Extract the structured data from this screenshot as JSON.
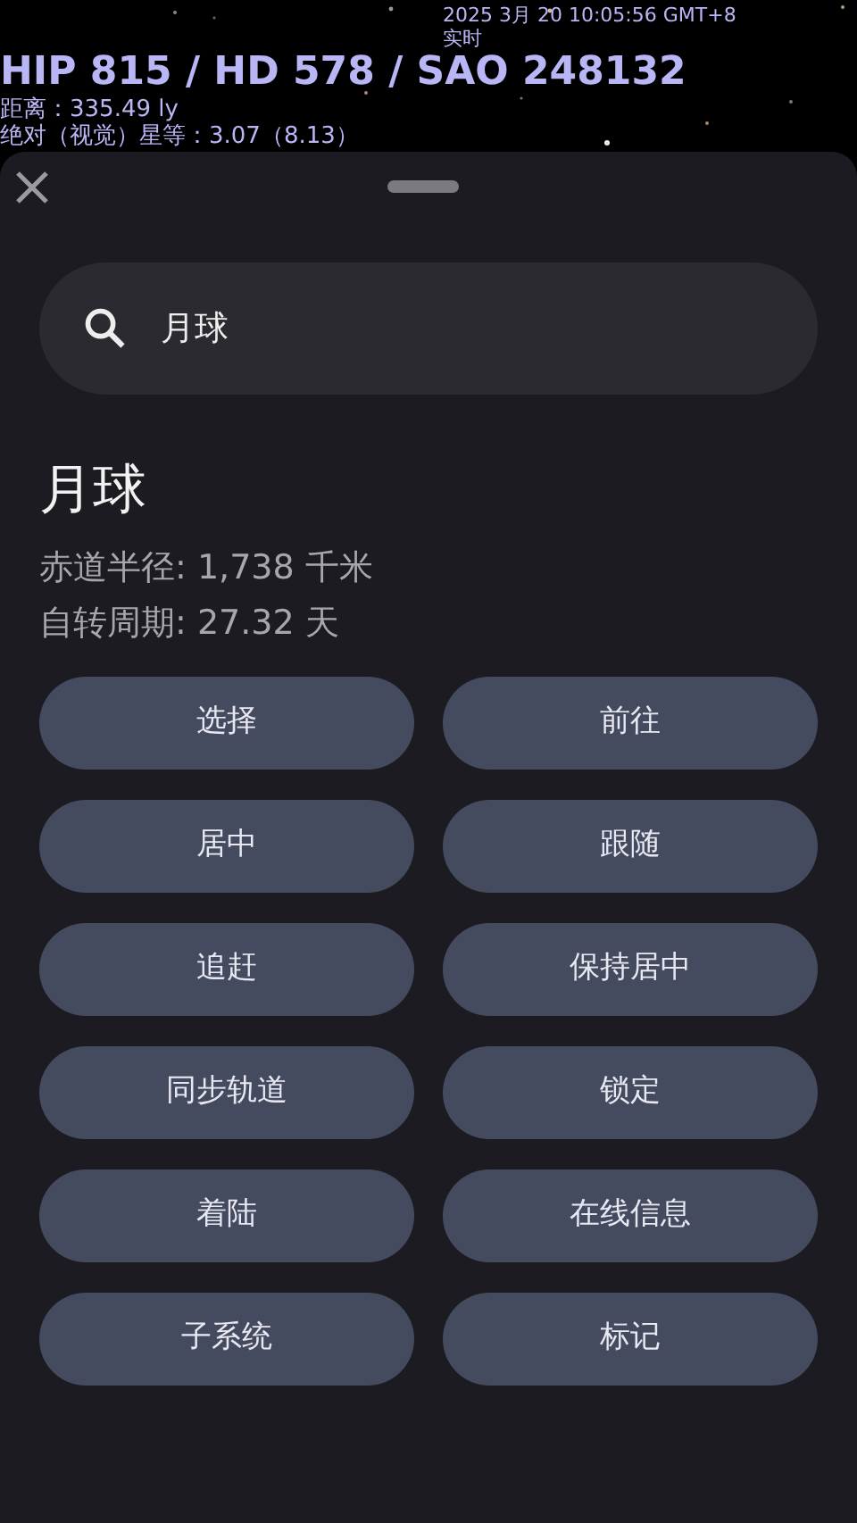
{
  "sky_overlay": {
    "object_title": "HIP 815 / HD 578 / SAO 248132",
    "distance": "距离：335.49 ly",
    "magnitude": "绝对（视觉）星等：3.07（8.13）",
    "datetime": "2025 3月 20 10:05:56 GMT+8",
    "time_mode": "实时"
  },
  "search": {
    "value": "月球"
  },
  "object": {
    "name": "月球",
    "details": [
      "赤道半径: 1,738 千米",
      "自转周期: 27.32 天"
    ]
  },
  "actions": [
    "选择",
    "前往",
    "居中",
    "跟随",
    "追赶",
    "保持居中",
    "同步轨道",
    "锁定",
    "着陆",
    "在线信息",
    "子系统",
    "标记"
  ]
}
